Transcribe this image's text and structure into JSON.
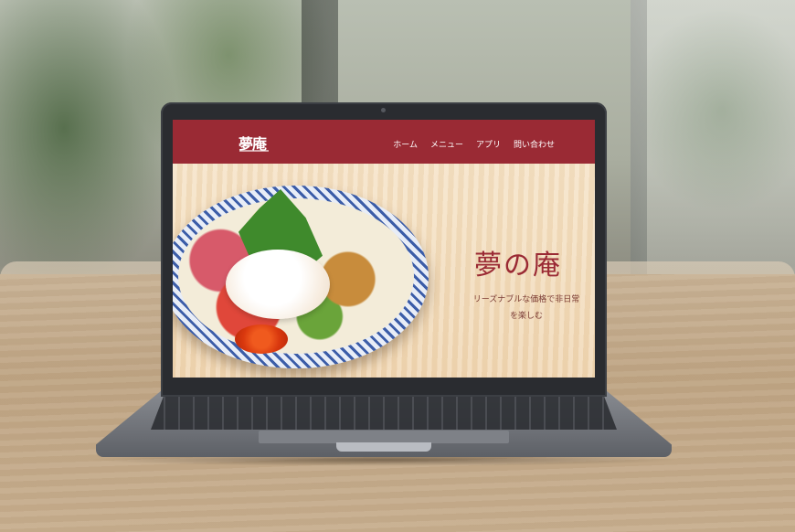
{
  "site": {
    "logo_text": "夢庵",
    "nav": [
      {
        "label": "ホーム"
      },
      {
        "label": "メニュー"
      },
      {
        "label": "アプリ"
      },
      {
        "label": "問い合わせ"
      }
    ]
  },
  "hero": {
    "title": "夢の庵",
    "subtitle_line1": "リーズナブルな価格で非日常",
    "subtitle_line2": "を楽しむ"
  },
  "colors": {
    "brand": "#9a2a34",
    "hero_background": "#f2dcbd"
  },
  "icons": [
    "camera-icon"
  ]
}
